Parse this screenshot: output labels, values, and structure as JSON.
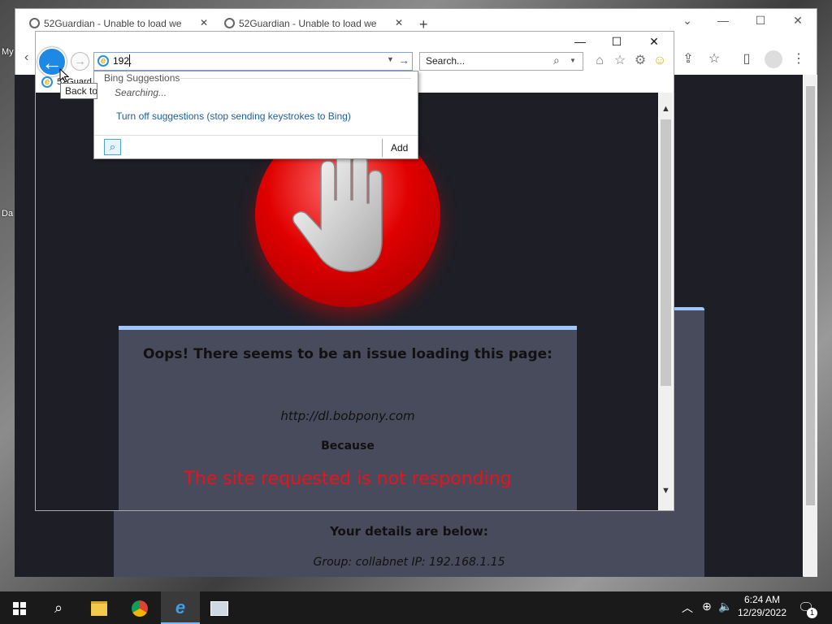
{
  "desktop": {
    "icon_label_1": "My",
    "icon_label_2": "Da"
  },
  "chrome": {
    "tabs": [
      {
        "title": "52Guardian - Unable to load we"
      },
      {
        "title": "52Guardian - Unable to load we"
      }
    ],
    "new_tab": "+",
    "controls": {
      "chevron": "⌄",
      "minimize": "—",
      "maximize": "☐",
      "close": "✕"
    }
  },
  "ie": {
    "controls": {
      "minimize": "—",
      "maximize": "☐",
      "close": "✕"
    },
    "address_value": "192.",
    "search_placeholder": "Search...",
    "tooltip": "Back to",
    "tab_text": "52Guard",
    "suggestions": {
      "title": "Bing Suggestions",
      "status": "Searching...",
      "turn_off": "Turn off suggestions (stop sending keystrokes to Bing)",
      "add_label": "Add"
    }
  },
  "page": {
    "error_title": "Oops! There seems to be an issue loading this page:",
    "url": "http://dl.bobpony.com",
    "because": "Because",
    "reason": "The site requested is not responding",
    "details_title": "Your details are below:",
    "details_info": "Group: collabnet   IP: 192.168.1.15"
  },
  "taskbar": {
    "time": "6:24 AM",
    "date": "12/29/2022",
    "notification_count": "1"
  },
  "colors": {
    "accent_blue": "#1e88e5",
    "error_red": "#e8131c",
    "card_bg": "#474b5b",
    "page_bg": "#1e1e26"
  }
}
